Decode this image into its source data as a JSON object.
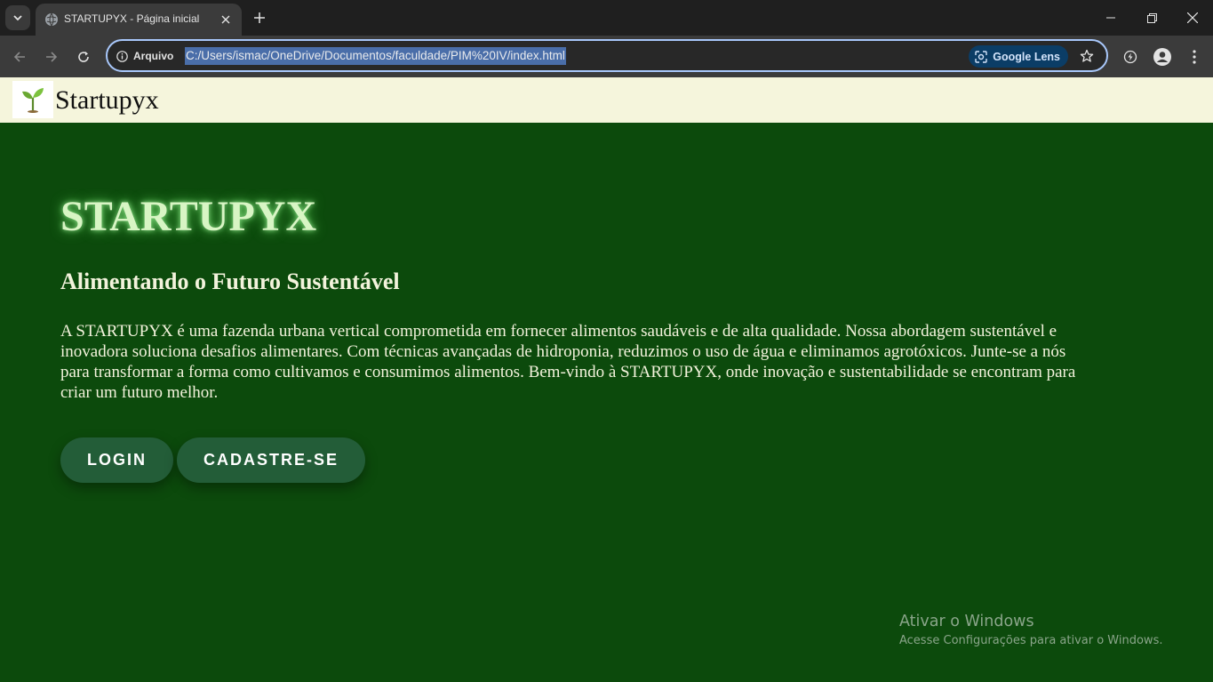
{
  "browser": {
    "tab_title": "STARTUPYX - Página inicial",
    "site_info_label": "Arquivo",
    "url": "C:/Users/ismac/OneDrive/Documentos/faculdade/PIM%20IV/index.html",
    "lens_label": "Google Lens",
    "colors": {
      "tabbar": "#1f1f1f",
      "toolbar": "#3b3b3b",
      "omnibox_border": "#a8c7fa",
      "url_selection": "#4a6ea9"
    }
  },
  "header": {
    "logo_icon": "seedling-icon",
    "brand": "Startupyx"
  },
  "hero": {
    "title": "STARTUPYX",
    "subtitle": "Alimentando o Futuro Sustentável",
    "description": "A STARTUPYX é uma fazenda urbana vertical comprometida em fornecer alimentos saudáveis e de alta qualidade. Nossa abordagem sustentável e inovadora soluciona desafios alimentares. Com técnicas avançadas de hidroponia, reduzimos o uso de água e eliminamos agrotóxicos. Junte-se a nós para transformar a forma como cultivamos e consumimos alimentos. Bem-vindo à STARTUPYX, onde inovação e sustentabilidade se encontram para criar um futuro melhor.",
    "login_label": "LOGIN",
    "signup_label": "CADASTRE-SE"
  },
  "watermark": {
    "title": "Ativar o Windows",
    "subtitle": "Acesse Configurações para ativar o Windows."
  },
  "colors": {
    "page_background": "#0c4a0c",
    "header_background": "#f5f5dc",
    "button_background": "#235d38",
    "title_glow": "#5fd15a"
  }
}
